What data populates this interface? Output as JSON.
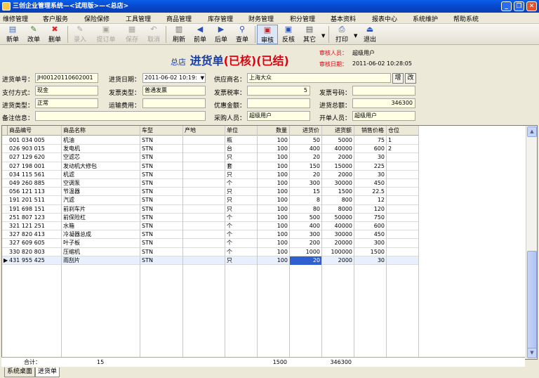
{
  "window": {
    "title": "三创企业管理系统—<试用版>—<总店>",
    "minimize": "_",
    "restore": "❐",
    "close": "✕"
  },
  "menu": [
    "维修管理",
    "客户服务",
    "保险保修",
    "工具管理",
    "商品管理",
    "库存管理",
    "财务管理",
    "积分管理",
    "基本资料",
    "报表中心",
    "系统维护",
    "帮助系统"
  ],
  "toolbar": [
    {
      "label": "新单",
      "icon": "new-doc-icon",
      "glyph": "▤",
      "enabled": true
    },
    {
      "label": "改单",
      "icon": "edit-icon",
      "glyph": "✎",
      "enabled": true
    },
    {
      "label": "删单",
      "icon": "delete-icon",
      "glyph": "✖",
      "enabled": true
    },
    {
      "label": "录入",
      "icon": "input-icon",
      "glyph": "✎",
      "enabled": false
    },
    {
      "label": "提订单",
      "icon": "order-icon",
      "glyph": "▣",
      "enabled": false
    },
    {
      "label": "保存",
      "icon": "save-icon",
      "glyph": "▦",
      "enabled": false
    },
    {
      "label": "取消",
      "icon": "cancel-icon",
      "glyph": "↶",
      "enabled": false
    },
    {
      "label": "刷新",
      "icon": "refresh-icon",
      "glyph": "▥",
      "enabled": true
    },
    {
      "label": "前单",
      "icon": "prev-icon",
      "glyph": "◀",
      "enabled": true
    },
    {
      "label": "后单",
      "icon": "next-icon",
      "glyph": "▶",
      "enabled": true
    },
    {
      "label": "查单",
      "icon": "find-icon",
      "glyph": "⚲",
      "enabled": true
    },
    {
      "label": "审核",
      "icon": "approve-icon",
      "glyph": "▣",
      "enabled": true
    },
    {
      "label": "反核",
      "icon": "unapprove-icon",
      "glyph": "▣",
      "enabled": true
    },
    {
      "label": "其它",
      "icon": "other-icon",
      "glyph": "▤",
      "enabled": true
    },
    {
      "label": "打印",
      "icon": "print-icon",
      "glyph": "⎙",
      "enabled": true
    },
    {
      "label": "退出",
      "icon": "exit-icon",
      "glyph": "⏏",
      "enabled": true
    }
  ],
  "doc": {
    "store": "总店",
    "title": "进货单",
    "status1": "(已核)",
    "status2": "(已结)",
    "auditor_label": "审核人员：",
    "auditor": "超级用户",
    "audit_date_label": "审核日期：",
    "audit_date": "2011-06-02 10:28:05"
  },
  "form": {
    "order_no_label": "进货单号：",
    "order_no": "JH00120110602001",
    "date_label": "进货日期：",
    "date": "2011-06-02 10:19:",
    "supplier_label": "供应商名：",
    "supplier": "上海大众",
    "add_btn": "增",
    "edit_btn": "改",
    "pay_label": "支付方式：",
    "pay": "现金",
    "invoice_type_label": "发票类型：",
    "invoice_type": "普通发票",
    "tax_label": "发票税率：",
    "tax": "5",
    "invoice_no_label": "发票号码：",
    "invoice_no": "",
    "buy_type_label": "进货类型：",
    "buy_type": "正常",
    "freight_label": "运输费用：",
    "freight": "",
    "discount_label": "优惠金额：",
    "discount": "",
    "total_label": "进货总额：",
    "total": "346300",
    "remark_label": "备注信息：",
    "remark": "",
    "buyer_label": "采购人员：",
    "buyer": "超级用户",
    "creator_label": "开单人员：",
    "creator": "超级用户"
  },
  "grid": {
    "headers": [
      "商品编号",
      "商品名称",
      "车型",
      "产地",
      "单位",
      "数量",
      "进货价",
      "进货额",
      "销售价格",
      "仓位"
    ],
    "rows": [
      [
        "001 034 005",
        "机油",
        "STN",
        "",
        "瓶",
        "100",
        "50",
        "5000",
        "75",
        "1"
      ],
      [
        "026 903 015",
        "发电机",
        "STN",
        "",
        "台",
        "100",
        "400",
        "40000",
        "600",
        "2"
      ],
      [
        "027 129 620",
        "空滤芯",
        "STN",
        "",
        "只",
        "100",
        "20",
        "2000",
        "30",
        ""
      ],
      [
        "027 198 001",
        "发动机大修包",
        "STN",
        "",
        "套",
        "100",
        "150",
        "15000",
        "225",
        ""
      ],
      [
        "034 115 561",
        "机滤",
        "STN",
        "",
        "只",
        "100",
        "20",
        "2000",
        "30",
        ""
      ],
      [
        "049 260 885",
        "空调泵",
        "STN",
        "",
        "个",
        "100",
        "300",
        "30000",
        "450",
        ""
      ],
      [
        "056 121 113",
        "节温器",
        "STN",
        "",
        "只",
        "100",
        "15",
        "1500",
        "22.5",
        ""
      ],
      [
        "191 201 511",
        "汽滤",
        "STN",
        "",
        "只",
        "100",
        "8",
        "800",
        "12",
        ""
      ],
      [
        "191 698 151",
        "前刹车片",
        "STN",
        "",
        "只",
        "100",
        "80",
        "8000",
        "120",
        ""
      ],
      [
        "251 807 123",
        "前保险杠",
        "STN",
        "",
        "个",
        "100",
        "500",
        "50000",
        "750",
        ""
      ],
      [
        "321 121 251",
        "水箱",
        "STN",
        "",
        "个",
        "100",
        "400",
        "40000",
        "600",
        ""
      ],
      [
        "327 820 413",
        "冷凝器总成",
        "STN",
        "",
        "个",
        "100",
        "300",
        "30000",
        "450",
        ""
      ],
      [
        "327 609 605",
        "叶子板",
        "STN",
        "",
        "个",
        "100",
        "200",
        "20000",
        "300",
        ""
      ],
      [
        "330 820 803",
        "压缩机",
        "STN",
        "",
        "个",
        "100",
        "1000",
        "100000",
        "1500",
        ""
      ],
      [
        "431 955 425",
        "雨刮片",
        "STN",
        "",
        "只",
        "100",
        "20",
        "2000",
        "30",
        ""
      ]
    ],
    "selected_row_marker": "▶"
  },
  "footer": {
    "label": "合计：",
    "count": "15",
    "qty": "1500",
    "amount": "346300"
  },
  "tabs": [
    "系统桌面",
    "进货单"
  ]
}
